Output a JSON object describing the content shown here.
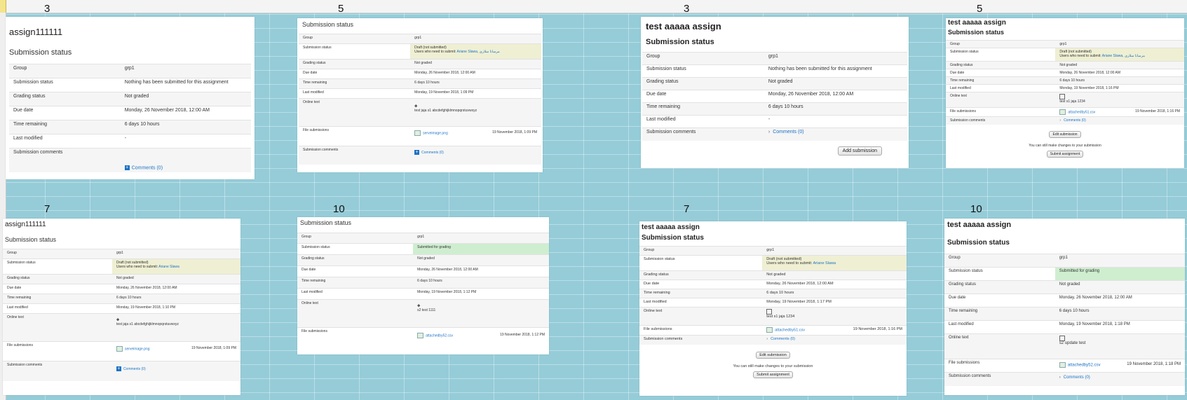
{
  "labels": {
    "num_a": "3",
    "num_b": "5",
    "num_c": "3",
    "num_d": "5",
    "num_e": "7",
    "num_f": "10",
    "num_g": "7",
    "num_h": "10"
  },
  "card1": {
    "heading": "assign111111",
    "subheading": "Submission status",
    "rows": {
      "group": {
        "label": "Group",
        "value": "grp1"
      },
      "status": {
        "label": "Submission status",
        "value": "Nothing has been submitted for this assignment"
      },
      "grading": {
        "label": "Grading status",
        "value": "Not graded"
      },
      "due": {
        "label": "Due date",
        "value": "Monday, 26 November 2018, 12:00 AM"
      },
      "remaining": {
        "label": "Time remaining",
        "value": "6 days 10 hours"
      },
      "modified": {
        "label": "Last modified",
        "value": "-"
      },
      "comments": {
        "label": "Submission comments",
        "value": "Comments (0)"
      }
    }
  },
  "card2": {
    "subheading": "Submission status",
    "rows": {
      "group": {
        "label": "Group",
        "value": "grp1"
      },
      "status": {
        "label": "Submission status",
        "value": "Draft (not submitted)",
        "need": "Users who need to submit:",
        "users": "Ariane Slawa, مرسانا سلاری"
      },
      "grading": {
        "label": "Grading status",
        "value": "Not graded"
      },
      "due": {
        "label": "Due date",
        "value": "Monday, 26 November 2018, 12:00 AM"
      },
      "remaining": {
        "label": "Time remaining",
        "value": "6 days 10 hours"
      },
      "modified": {
        "label": "Last modified",
        "value": "Monday, 19 November 2018, 1:09 PM"
      },
      "online": {
        "label": "Online text",
        "value": "test jaja s1 abcdefghijklmnopqrstuvwxyz"
      },
      "files": {
        "label": "File submissions",
        "file": "serveimage.png",
        "date": "19 November 2018, 1:09 PM"
      },
      "comments": {
        "label": "Submission comments",
        "value": "Comments (0)"
      }
    }
  },
  "card3": {
    "heading": "test aaaaa assign",
    "subheading": "Submission status",
    "rows": {
      "group": {
        "label": "Group",
        "value": "grp1"
      },
      "status": {
        "label": "Submission status",
        "value": "Nothing has been submitted for this assignment"
      },
      "grading": {
        "label": "Grading status",
        "value": "Not graded"
      },
      "due": {
        "label": "Due date",
        "value": "Monday, 26 November 2018, 12:00 AM"
      },
      "remaining": {
        "label": "Time remaining",
        "value": "6 days 10 hours"
      },
      "modified": {
        "label": "Last modified",
        "value": "-"
      },
      "comments": {
        "label": "Submission comments",
        "value": "Comments (0)"
      }
    },
    "button": "Add submission"
  },
  "card4": {
    "heading": "test aaaaa assign",
    "subheading": "Submission status",
    "rows": {
      "group": {
        "label": "Group",
        "value": "grp1"
      },
      "status": {
        "label": "Submission status",
        "value": "Draft (not submitted)",
        "need": "Users who need to submit:",
        "users": "Ariane Slawa, مرسانا سلاری"
      },
      "grading": {
        "label": "Grading status",
        "value": "Not graded"
      },
      "due": {
        "label": "Due date",
        "value": "Monday, 26 November 2018, 12:00 AM"
      },
      "remaining": {
        "label": "Time remaining",
        "value": "6 days 10 hours"
      },
      "modified": {
        "label": "Last modified",
        "value": "Monday, 19 November 2018, 1:16 PM"
      },
      "online": {
        "label": "Online text",
        "value": "test s1 jaja 1234"
      },
      "files": {
        "label": "File submissions",
        "file": "attachedby51.csv",
        "date": "19 November 2018, 1:16 PM"
      },
      "comments": {
        "label": "Submission comments",
        "value": "Comments (0)"
      }
    },
    "edit_button": "Edit submission",
    "note": "You can still make changes to your submission",
    "submit_button": "Submit assignment"
  },
  "card5": {
    "heading": "assign111111",
    "subheading": "Submission status",
    "rows": {
      "group": {
        "label": "Group",
        "value": "grp1"
      },
      "status": {
        "label": "Submission status",
        "value": "Draft (not submitted)",
        "need": "Users who need to submit:",
        "users": "Ariane Slawa"
      },
      "grading": {
        "label": "Grading status",
        "value": "Not graded"
      },
      "due": {
        "label": "Due date",
        "value": "Monday, 26 November 2018, 12:00 AM"
      },
      "remaining": {
        "label": "Time remaining",
        "value": "6 days 10 hours"
      },
      "modified": {
        "label": "Last modified",
        "value": "Monday, 19 November 2018, 1:10 PM"
      },
      "online": {
        "label": "Online text",
        "value": "test jaja s1 abcdefghijklmnopqrstuvwxyz"
      },
      "files": {
        "label": "File submissions",
        "file": "serveimage.png",
        "date": "19 November 2018, 1:09 PM"
      },
      "comments": {
        "label": "Submission comments",
        "value": "Comments (0)"
      }
    }
  },
  "card6": {
    "subheading": "Submission status",
    "rows": {
      "group": {
        "label": "Group",
        "value": "grp1"
      },
      "status": {
        "label": "Submission status",
        "value": "Submitted for grading"
      },
      "grading": {
        "label": "Grading status",
        "value": "Not graded"
      },
      "due": {
        "label": "Due date",
        "value": "Monday, 26 November 2018, 12:00 AM"
      },
      "remaining": {
        "label": "Time remaining",
        "value": "6 days 10 hours"
      },
      "modified": {
        "label": "Last modified",
        "value": "Monday, 19 November 2018, 1:12 PM"
      },
      "online": {
        "label": "Online text",
        "value": "s2 test 1111"
      },
      "files": {
        "label": "File submissions",
        "file": "attachedby52.csv",
        "date": "19 November 2018, 1:12 PM"
      }
    }
  },
  "card7": {
    "heading": "test aaaaa assign",
    "subheading": "Submission status",
    "rows": {
      "group": {
        "label": "Group",
        "value": "grp1"
      },
      "status": {
        "label": "Submission status",
        "value": "Draft (not submitted)",
        "need": "Users who need to submit:",
        "users": "Ariane Slawa"
      },
      "grading": {
        "label": "Grading status",
        "value": "Not graded"
      },
      "due": {
        "label": "Due date",
        "value": "Monday, 26 November 2018, 12:00 AM"
      },
      "remaining": {
        "label": "Time remaining",
        "value": "6 days 10 hours"
      },
      "modified": {
        "label": "Last modified",
        "value": "Monday, 19 November 2018, 1:17 PM"
      },
      "online": {
        "label": "Online text",
        "value": "test s1 jaja 1234"
      },
      "files": {
        "label": "File submissions",
        "file": "attachedby51.csv",
        "date": "19 November 2018, 1:16 PM"
      },
      "comments": {
        "label": "Submission comments",
        "value": "Comments (0)"
      }
    },
    "edit_button": "Edit submission",
    "note": "You can still make changes to your submission",
    "submit_button": "Submit assignment"
  },
  "card8": {
    "heading": "test aaaaa assign",
    "subheading": "Submission status",
    "rows": {
      "group": {
        "label": "Group",
        "value": "grp1"
      },
      "status": {
        "label": "Submission status",
        "value": "Submitted for grading"
      },
      "grading": {
        "label": "Grading status",
        "value": "Not graded"
      },
      "due": {
        "label": "Due date",
        "value": "Monday, 26 November 2018, 12:00 AM"
      },
      "remaining": {
        "label": "Time remaining",
        "value": "6 days 10 hours"
      },
      "modified": {
        "label": "Last modified",
        "value": "Monday, 19 November 2018, 1:18 PM"
      },
      "online": {
        "label": "Online text",
        "value": "s2 update test"
      },
      "files": {
        "label": "File submissions",
        "file": "attachedby52.csv",
        "date": "19 November 2018, 1:18 PM"
      },
      "comments": {
        "label": "Submission comments",
        "value": "Comments (0)"
      }
    }
  }
}
